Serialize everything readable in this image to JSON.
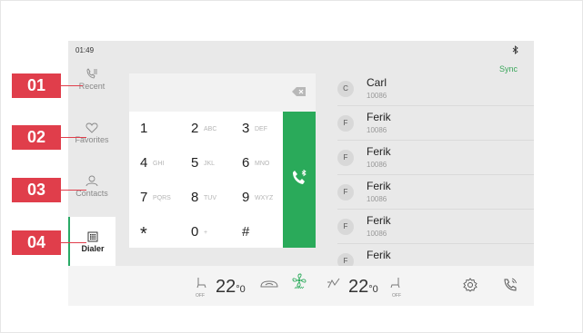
{
  "status_bar": {
    "time": "01:49",
    "bt_icon": "bluetooth-icon"
  },
  "sync_label": "Sync",
  "nav": [
    {
      "label": "Recent",
      "icon": "recent-calls-icon"
    },
    {
      "label": "Favorites",
      "icon": "heart-icon"
    },
    {
      "label": "Contacts",
      "icon": "person-icon"
    },
    {
      "label": "Dialer",
      "icon": "keypad-icon",
      "active": true
    }
  ],
  "keypad": [
    {
      "num": "1",
      "letters": ""
    },
    {
      "num": "2",
      "letters": "ABC"
    },
    {
      "num": "3",
      "letters": "DEF"
    },
    {
      "num": "4",
      "letters": "GHI"
    },
    {
      "num": "5",
      "letters": "JKL"
    },
    {
      "num": "6",
      "letters": "MNO"
    },
    {
      "num": "7",
      "letters": "PQRS"
    },
    {
      "num": "8",
      "letters": "TUV"
    },
    {
      "num": "9",
      "letters": "WXYZ"
    },
    {
      "num": "*",
      "letters": ""
    },
    {
      "num": "0",
      "letters": "+"
    },
    {
      "num": "#",
      "letters": ""
    }
  ],
  "contacts": [
    {
      "initial": "C",
      "name": "Carl",
      "number": "10086"
    },
    {
      "initial": "F",
      "name": "Ferik",
      "number": "10086"
    },
    {
      "initial": "F",
      "name": "Ferik",
      "number": "10086"
    },
    {
      "initial": "F",
      "name": "Ferik",
      "number": "10086"
    },
    {
      "initial": "F",
      "name": "Ferik",
      "number": "10086"
    },
    {
      "initial": "F",
      "name": "Ferik",
      "number": ""
    }
  ],
  "climate": {
    "left_temp": "22",
    "left_temp_decimal": "0",
    "right_temp": "22",
    "right_temp_decimal": "0",
    "seat_left_label": "OFF",
    "seat_right_label": "OFF"
  },
  "callouts": [
    "01",
    "02",
    "03",
    "04"
  ],
  "colors": {
    "accent": "#2aaa5a",
    "callout": "#e03e4b",
    "sync": "#3aa65a"
  }
}
